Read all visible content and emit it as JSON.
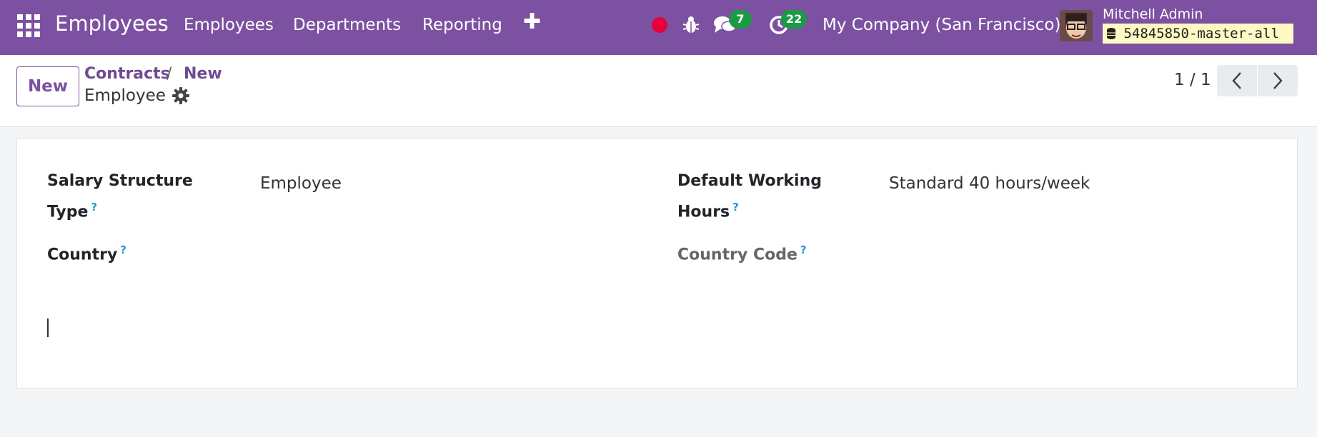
{
  "navbar": {
    "app_title": "Employees",
    "menu": [
      "Employees",
      "Departments",
      "Reporting"
    ],
    "messages_count": "7",
    "activities_count": "22",
    "company": "My Company (San Francisco)",
    "user_name": "Mitchell Admin",
    "database": "54845850-master-all",
    "brand_color": "#7c51a1"
  },
  "control_panel": {
    "new_label": "New",
    "breadcrumb": [
      "Contracts",
      "New"
    ],
    "breadcrumb_separator": "/",
    "record_name": "Employee",
    "pager": "1 / 1"
  },
  "form": {
    "salary_structure_type": {
      "label_line1": "Salary Structure",
      "label_line2": "Type",
      "value": "Employee"
    },
    "default_working_hours": {
      "label_line1": "Default Working",
      "label_line2": "Hours",
      "value": "Standard 40 hours/week"
    },
    "country": {
      "label": "Country",
      "value": ""
    },
    "country_code": {
      "label": "Country Code",
      "value": ""
    },
    "help_mark": "?"
  }
}
